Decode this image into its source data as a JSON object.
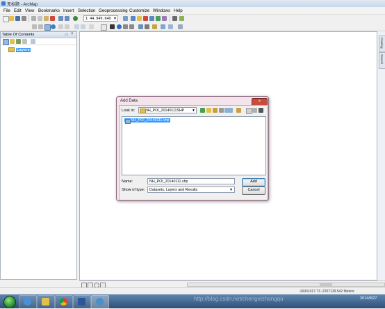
{
  "window": {
    "title": "无标题 - ArcMap"
  },
  "menu": [
    "File",
    "Edit",
    "View",
    "Bookmarks",
    "Insert",
    "Selection",
    "Geoprocessing",
    "Customize",
    "Windows",
    "Help"
  ],
  "toolbar": {
    "scale": "1: 44, 949, 640"
  },
  "toc": {
    "title": "Table Of Contents",
    "root": "Layers"
  },
  "right_dock": [
    "Catalog",
    "Search"
  ],
  "dialog": {
    "title": "Add Data",
    "lookin_label": "Look in:",
    "lookin_value": "NH_POI_20140111SHP",
    "files": [
      "NH_POI_20140111.shp"
    ],
    "name_label": "Name:",
    "name_value": "NH_POI_20140111.shp",
    "type_label": "Show of type:",
    "type_value": "Datasets, Layers and Results",
    "add_label": "Add",
    "cancel_label": "Cancel"
  },
  "status": {
    "coords": "-16931017.73  -2207139.542 Meters"
  },
  "taskbar": {
    "clock_date": "2014/8/27"
  },
  "watermark": "http://blog.csdn.net/chengeizhongqu"
}
